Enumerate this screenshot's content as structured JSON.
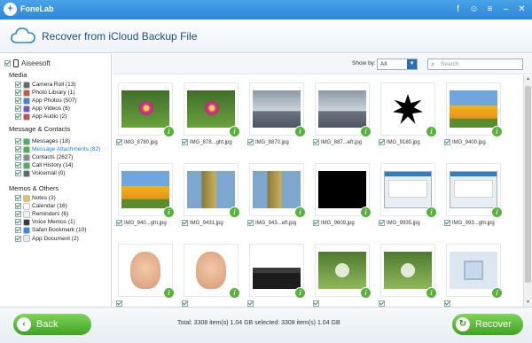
{
  "app": {
    "name": "FoneLab"
  },
  "header": {
    "title": "Recover from iCloud Backup File"
  },
  "sidebar": {
    "root": "Aiseesoft",
    "sections": [
      {
        "title": "Media",
        "items": [
          {
            "label": "Camera Roll (13)",
            "icon": "camera-roll-icon",
            "color": "#6a6a6a"
          },
          {
            "label": "Photo Library (1)",
            "icon": "photo-library-icon",
            "color": "#d8552c"
          },
          {
            "label": "App Photos (507)",
            "icon": "app-photos-icon",
            "color": "#3f86d8"
          },
          {
            "label": "App Videos (6)",
            "icon": "app-videos-icon",
            "color": "#7a52c9"
          },
          {
            "label": "App Audio (2)",
            "icon": "app-audio-icon",
            "color": "#e0453a"
          }
        ]
      },
      {
        "title": "Message & Contacts",
        "items": [
          {
            "label": "Messages (18)",
            "icon": "messages-icon",
            "color": "#44b84a"
          },
          {
            "label": "Message Attachments (82)",
            "icon": "attachments-icon",
            "color": "#44b84a"
          },
          {
            "label": "Contacts (2627)",
            "icon": "contacts-icon",
            "color": "#8c8c8c"
          },
          {
            "label": "Call History (14)",
            "icon": "call-history-icon",
            "color": "#44b84a"
          },
          {
            "label": "Voicemail (0)",
            "icon": "voicemail-icon",
            "color": "#5a6a7a"
          }
        ]
      },
      {
        "title": "Memos & Others",
        "items": [
          {
            "label": "Notes (3)",
            "icon": "notes-icon",
            "color": "#e8c640"
          },
          {
            "label": "Calendar (16)",
            "icon": "calendar-icon",
            "color": "#ffffff"
          },
          {
            "label": "Reminders (6)",
            "icon": "reminders-icon",
            "color": "#f2f2f2"
          },
          {
            "label": "Voice Memos (1)",
            "icon": "voice-memos-icon",
            "color": "#3a3a3a"
          },
          {
            "label": "Safari Bookmark (10)",
            "icon": "safari-icon",
            "color": "#2f8ce0"
          },
          {
            "label": "App Document (2)",
            "icon": "app-document-icon",
            "color": "#e8e8e8"
          }
        ]
      }
    ]
  },
  "toolbar": {
    "show_by_label": "Show by:",
    "show_by_value": "All",
    "search_placeholder": "Search"
  },
  "photos": [
    {
      "label": "IMG_8780.jpg",
      "style": "flower"
    },
    {
      "label": "IMG_878...ght.jpg",
      "style": "flower"
    },
    {
      "label": "IMG_8870.jpg",
      "style": "sky"
    },
    {
      "label": "IMG_887...eft.jpg",
      "style": "sky"
    },
    {
      "label": "IMG_9180.jpg",
      "style": "stamp"
    },
    {
      "label": "IMG_9400.jpg",
      "style": "tulips"
    },
    {
      "label": "IMG_940...ght.jpg",
      "style": "tulips"
    },
    {
      "label": "IMG_9431.jpg",
      "style": "tree"
    },
    {
      "label": "IMG_943...eft.jpg",
      "style": "tree"
    },
    {
      "label": "IMG_9609.jpg",
      "style": "black"
    },
    {
      "label": "IMG_9935.jpg",
      "style": "screen"
    },
    {
      "label": "IMG_993...ght.jpg",
      "style": "screen"
    },
    {
      "label": "",
      "style": "baby"
    },
    {
      "label": "",
      "style": "baby"
    },
    {
      "label": "",
      "style": "dark"
    },
    {
      "label": "",
      "style": "video"
    },
    {
      "label": "",
      "style": "video"
    },
    {
      "label": "",
      "style": "film"
    }
  ],
  "footer": {
    "back_label": "Back",
    "recover_label": "Recover",
    "totals": "Total: 3308 item(s) 1.04 GB   selected: 3308 item(s) 1.04 GB"
  }
}
